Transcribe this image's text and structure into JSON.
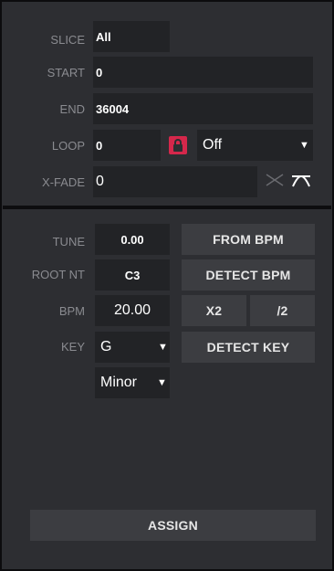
{
  "top": {
    "slice": {
      "label": "SLICE",
      "value": "All"
    },
    "start": {
      "label": "START",
      "value": "0"
    },
    "end": {
      "label": "END",
      "value": "36004"
    },
    "loop": {
      "label": "LOOP",
      "value": "0",
      "mode": "Off",
      "lock_icon": "lock-icon",
      "lock_color": "#d5274b"
    },
    "xfade": {
      "label": "X-FADE",
      "value": "0",
      "curve_linear_icon": "crossfade-linear-icon",
      "curve_power_icon": "crossfade-curve-icon"
    }
  },
  "bottom": {
    "tune": {
      "label": "TUNE",
      "value": "0.00"
    },
    "root": {
      "label": "ROOT NT",
      "value": "C3"
    },
    "bpm": {
      "label": "BPM",
      "value": "20.00"
    },
    "key": {
      "label": "KEY",
      "value": "G",
      "scale": "Minor"
    },
    "buttons": {
      "from_bpm": "FROM BPM",
      "detect_bpm": "DETECT BPM",
      "x2": "X2",
      "half": "/2",
      "detect_key": "DETECT KEY",
      "assign": "ASSIGN"
    }
  }
}
